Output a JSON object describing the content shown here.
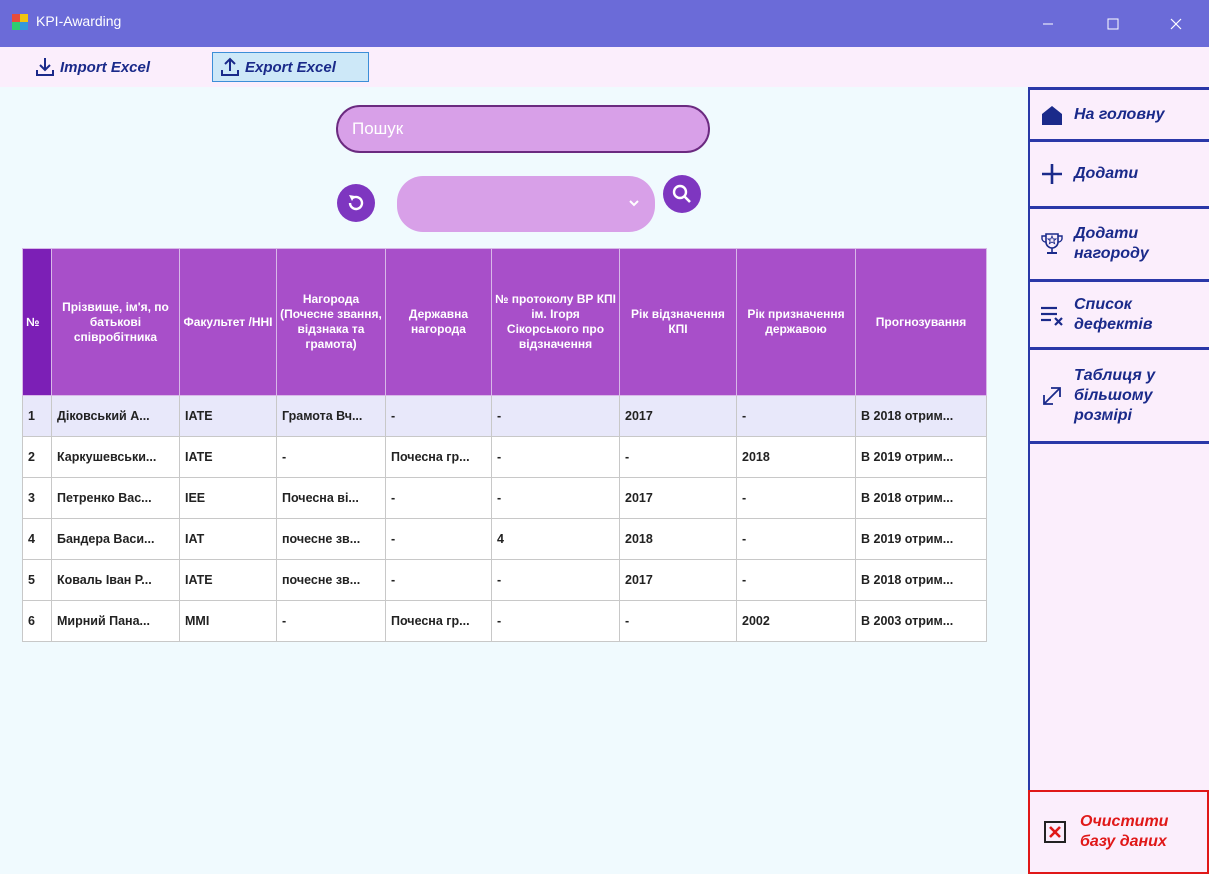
{
  "window": {
    "title": "KPI-Awarding"
  },
  "toolbar": {
    "import_label": "Import Excel",
    "export_label": "Export Excel"
  },
  "search": {
    "placeholder": "Пошук",
    "filter_value": ""
  },
  "table": {
    "headers": [
      "№",
      "Прізвище, ім'я, по батькові співробітника",
      "Факультет /ННІ",
      "Нагорода (Почесне звання, відзнака та грамота)",
      "Державна нагорода",
      "№ протоколу ВР КПІ ім. Ігоря Сікорського про відзначення",
      "Рік відзначення КПІ",
      "Рік призначення державою",
      "Прогнозування"
    ],
    "rows": [
      [
        "1",
        "Діковський А...",
        "IATE",
        "Грамота Вч...",
        "-",
        "-",
        "2017",
        "-",
        "В 2018 отрим..."
      ],
      [
        "2",
        "Каркушевськи...",
        "IATE",
        "-",
        "Почесна гр...",
        "-",
        "-",
        "2018",
        "В 2019 отрим..."
      ],
      [
        "3",
        "Петренко Вас...",
        "IEE",
        "Почесна ві...",
        "-",
        "-",
        "2017",
        "-",
        "В 2018 отрим..."
      ],
      [
        "4",
        "Бандера Васи...",
        "IAT",
        "почесне зв...",
        "-",
        "4",
        "2018",
        "-",
        "В 2019 отрим..."
      ],
      [
        "5",
        "Коваль Іван Р...",
        "IATE",
        "почесне зв...",
        "-",
        "-",
        "2017",
        "-",
        "В 2018 отрим..."
      ],
      [
        "6",
        "Мирний Пана...",
        "MMI",
        "-",
        "Почесна гр...",
        "-",
        "-",
        "2002",
        "В 2003 отрим..."
      ]
    ]
  },
  "sidebar": {
    "home": "На головну",
    "add": "Додати",
    "add_award": "Додати нагороду",
    "defects": "Список дефектів",
    "bigger_table": "Таблиця у більшому розмірі",
    "clear_db": "Очистити базу даних"
  }
}
